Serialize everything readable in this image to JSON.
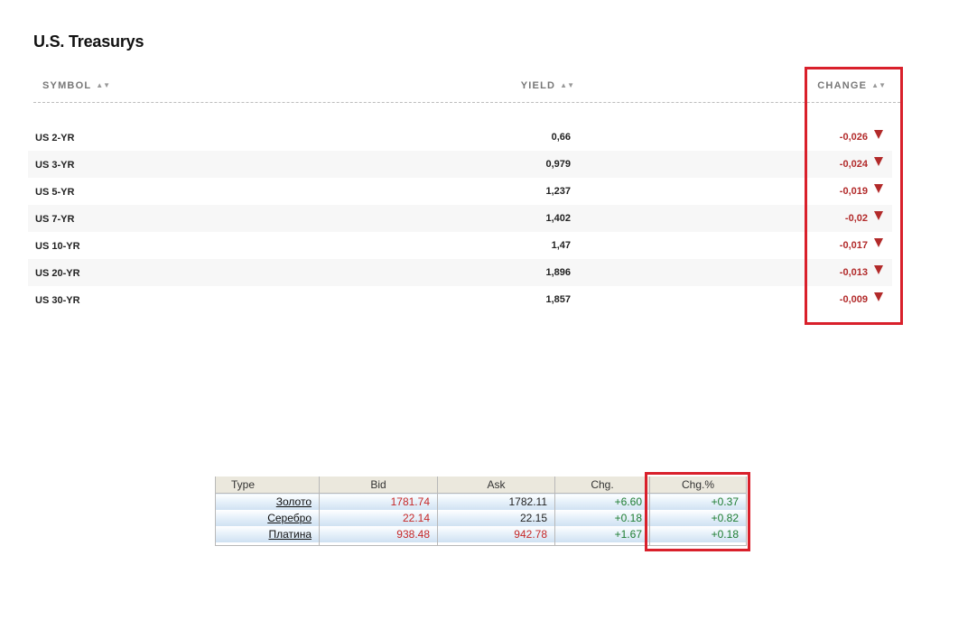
{
  "treasurys": {
    "title": "U.S. Treasurys",
    "columns": {
      "symbol": "SYMBOL",
      "yield": "YIELD",
      "change": "CHANGE",
      "sort_glyph": "▲▼"
    },
    "rows": [
      {
        "symbol": "US 2-YR",
        "yield": "0,66",
        "change": "-0,026",
        "direction": "down"
      },
      {
        "symbol": "US 3-YR",
        "yield": "0,979",
        "change": "-0,024",
        "direction": "down"
      },
      {
        "symbol": "US 5-YR",
        "yield": "1,237",
        "change": "-0,019",
        "direction": "down"
      },
      {
        "symbol": "US 7-YR",
        "yield": "1,402",
        "change": "-0,02",
        "direction": "down"
      },
      {
        "symbol": "US 10-YR",
        "yield": "1,47",
        "change": "-0,017",
        "direction": "down"
      },
      {
        "symbol": "US 20-YR",
        "yield": "1,896",
        "change": "-0,013",
        "direction": "down"
      },
      {
        "symbol": "US 30-YR",
        "yield": "1,857",
        "change": "-0,009",
        "direction": "down"
      }
    ]
  },
  "metals": {
    "headers": {
      "type": "Type",
      "bid": "Bid",
      "ask": "Ask",
      "chg": "Chg.",
      "chg_pct": "Chg.%"
    },
    "rows": [
      {
        "type": "Золото",
        "bid": "1781.74",
        "ask": "1782.11",
        "chg": "+6.60",
        "chg_pct": "+0.37"
      },
      {
        "type": "Серебро",
        "bid": "22.14",
        "ask": "22.15",
        "chg": "+0.18",
        "chg_pct": "+0.82"
      },
      {
        "type": "Платина",
        "bid": "938.48",
        "ask": "942.78",
        "chg": "+1.67",
        "chg_pct": "+0.18"
      }
    ]
  },
  "colors": {
    "negative": "#b22a2a",
    "positive": "#1e7d32",
    "highlight": "#d9202b"
  }
}
